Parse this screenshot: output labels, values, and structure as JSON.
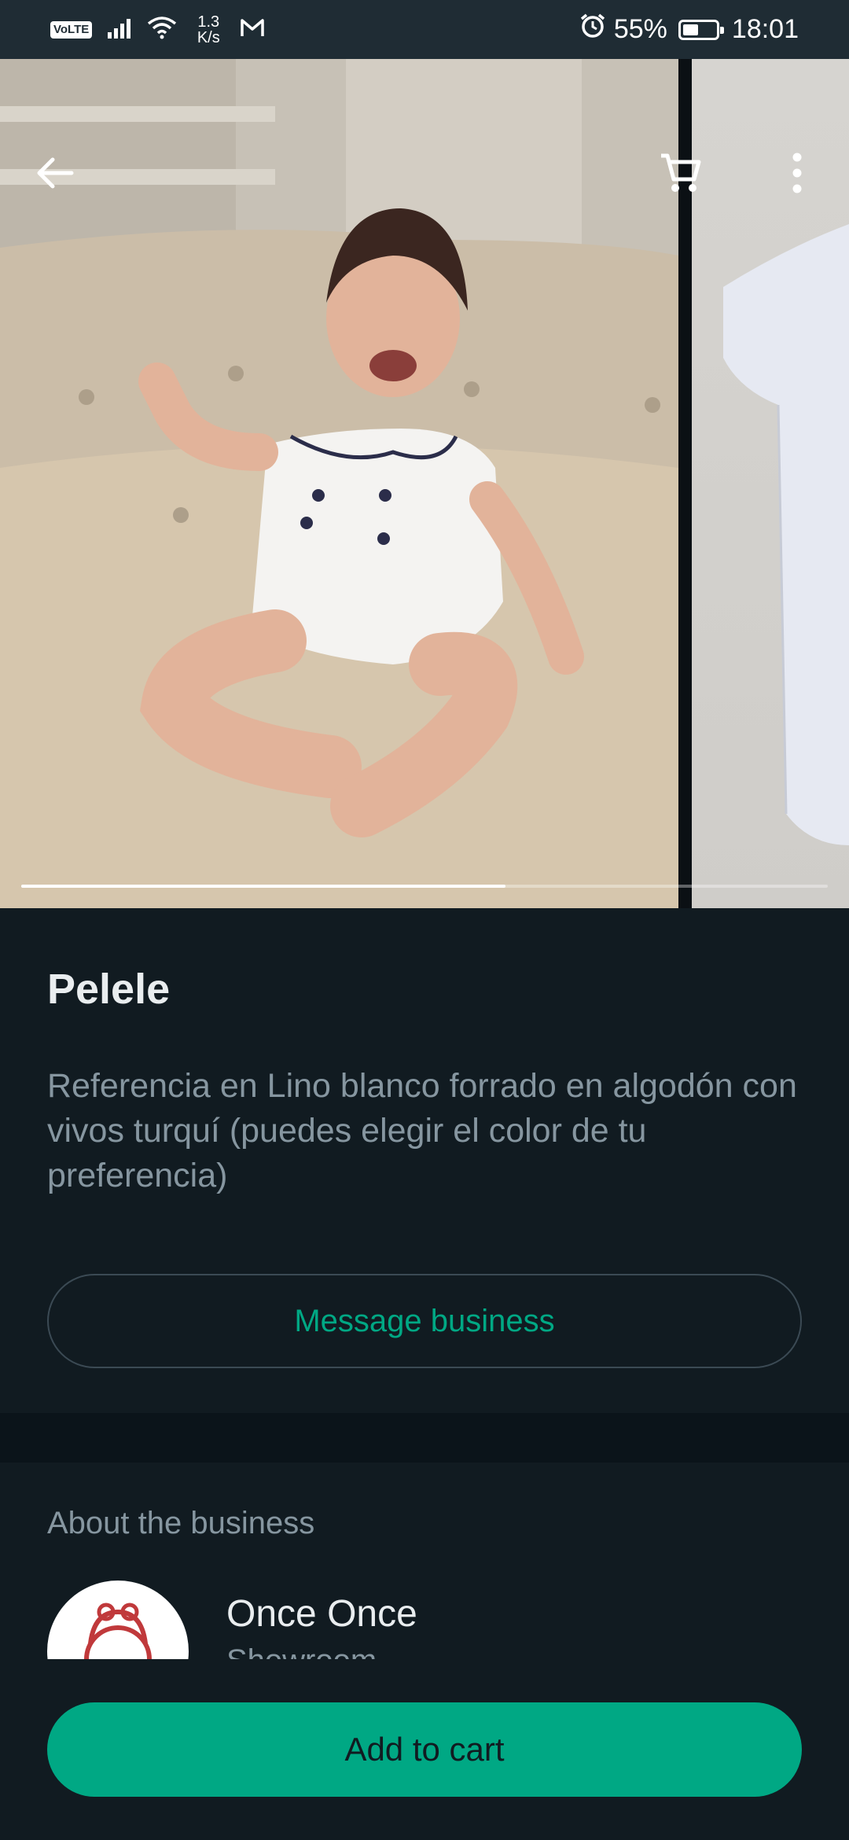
{
  "status_bar": {
    "volte": "VoLTE",
    "speed_value": "1.3",
    "speed_unit": "K/s",
    "battery": "55%",
    "battery_level": 0.55,
    "time": "18:01"
  },
  "carousel": {
    "image_count_visible": 2,
    "progress_fraction": 0.6
  },
  "product": {
    "name": "Pelele",
    "description": "Referencia en Lino blanco forrado en algodón con vivos turquí (puedes elegir el color de tu preferencia)",
    "message_label": "Message business"
  },
  "about": {
    "heading": "About the business",
    "business_name": "Once Once",
    "business_category": "Showroom"
  },
  "actions": {
    "add_to_cart": "Add to cart"
  },
  "colors": {
    "accent": "#00a884",
    "background": "#111b21",
    "status_bar": "#1f2c34"
  },
  "icons": {
    "back": "arrow-left-icon",
    "cart": "cart-icon",
    "menu": "more-vertical-icon"
  }
}
